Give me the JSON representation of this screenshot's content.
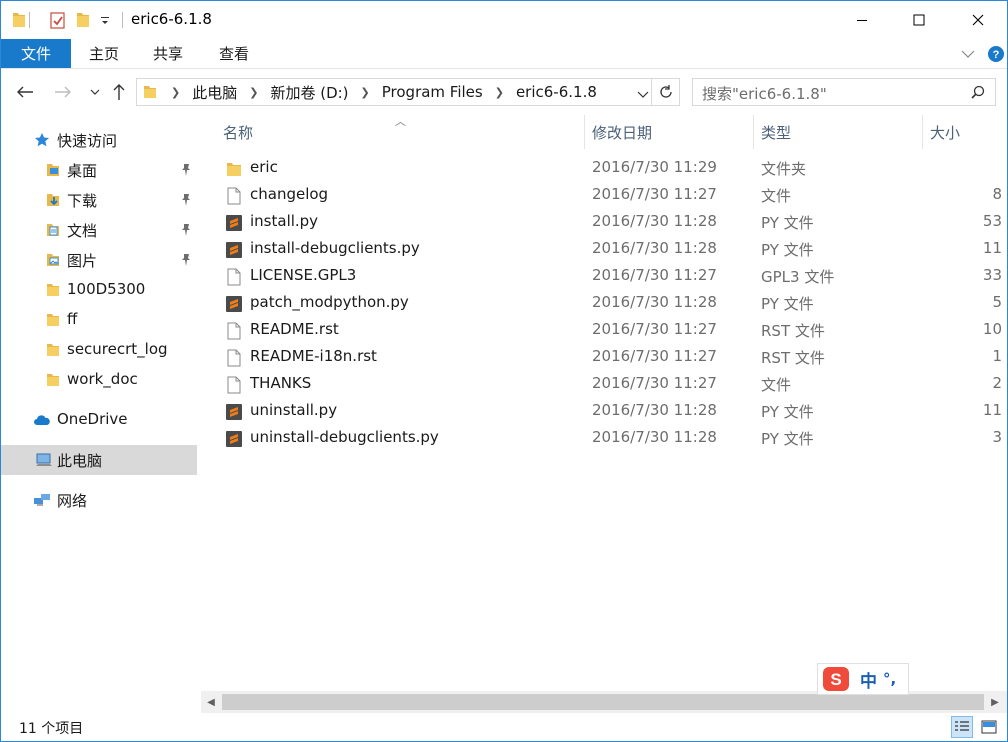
{
  "window": {
    "title": "eric6-6.1.8"
  },
  "ribbon": {
    "tabs": [
      "文件",
      "主页",
      "共享",
      "查看"
    ]
  },
  "address": {
    "crumbs": [
      "此电脑",
      "新加卷 (D:)",
      "Program Files",
      "eric6-6.1.8"
    ]
  },
  "search": {
    "placeholder": "搜索\"eric6-6.1.8\""
  },
  "sidebar": {
    "quick_access": "快速访问",
    "items": [
      {
        "label": "桌面",
        "icon": "desktop-icon",
        "pinned": true
      },
      {
        "label": "下载",
        "icon": "downloads-icon",
        "pinned": true
      },
      {
        "label": "文档",
        "icon": "documents-icon",
        "pinned": true
      },
      {
        "label": "图片",
        "icon": "pictures-icon",
        "pinned": true
      },
      {
        "label": "100D5300",
        "icon": "folder-icon",
        "pinned": false
      },
      {
        "label": "ff",
        "icon": "folder-icon",
        "pinned": false
      },
      {
        "label": "securecrt_log",
        "icon": "folder-icon",
        "pinned": false
      },
      {
        "label": "work_doc",
        "icon": "folder-icon",
        "pinned": false
      }
    ],
    "onedrive": "OneDrive",
    "this_pc": "此电脑",
    "network": "网络"
  },
  "columns": {
    "name": "名称",
    "date": "修改日期",
    "type": "类型",
    "size": "大小"
  },
  "files": [
    {
      "name": "eric",
      "date": "2016/7/30 11:29",
      "type": "文件夹",
      "size": "",
      "icon": "folder-icon"
    },
    {
      "name": "changelog",
      "date": "2016/7/30 11:27",
      "type": "文件",
      "size": "8",
      "icon": "file-icon"
    },
    {
      "name": "install.py",
      "date": "2016/7/30 11:28",
      "type": "PY 文件",
      "size": "53",
      "icon": "sublime-file-icon"
    },
    {
      "name": "install-debugclients.py",
      "date": "2016/7/30 11:28",
      "type": "PY 文件",
      "size": "11",
      "icon": "sublime-file-icon"
    },
    {
      "name": "LICENSE.GPL3",
      "date": "2016/7/30 11:27",
      "type": "GPL3 文件",
      "size": "33",
      "icon": "file-icon"
    },
    {
      "name": "patch_modpython.py",
      "date": "2016/7/30 11:28",
      "type": "PY 文件",
      "size": "5",
      "icon": "sublime-file-icon"
    },
    {
      "name": "README.rst",
      "date": "2016/7/30 11:27",
      "type": "RST 文件",
      "size": "10",
      "icon": "file-icon"
    },
    {
      "name": "README-i18n.rst",
      "date": "2016/7/30 11:27",
      "type": "RST 文件",
      "size": "1",
      "icon": "file-icon"
    },
    {
      "name": "THANKS",
      "date": "2016/7/30 11:27",
      "type": "文件",
      "size": "2",
      "icon": "file-icon"
    },
    {
      "name": "uninstall.py",
      "date": "2016/7/30 11:28",
      "type": "PY 文件",
      "size": "11",
      "icon": "sublime-file-icon"
    },
    {
      "name": "uninstall-debugclients.py",
      "date": "2016/7/30 11:28",
      "type": "PY 文件",
      "size": "3",
      "icon": "sublime-file-icon"
    }
  ],
  "status": {
    "count": "11 个项目"
  },
  "ime": {
    "mode": "中",
    "punct": "°,"
  },
  "colors": {
    "accent": "#1979ca",
    "folder": "#e8b84a",
    "sublime": "#ef7d1a"
  }
}
